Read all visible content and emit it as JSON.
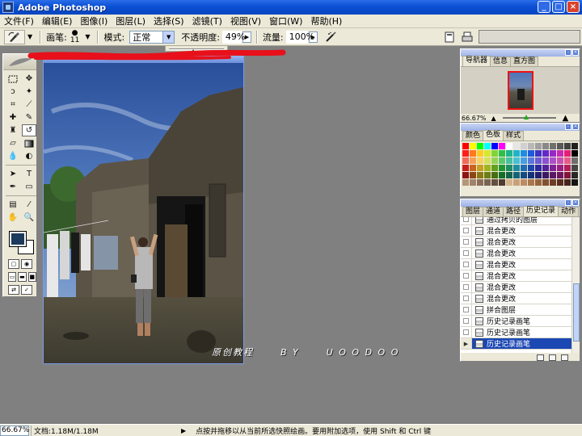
{
  "app": {
    "title": "Adobe Photoshop"
  },
  "window_buttons": {
    "minimize": "_",
    "maximize": "□",
    "close": "×"
  },
  "menu": [
    {
      "label": "文件(F)"
    },
    {
      "label": "编辑(E)"
    },
    {
      "label": "图像(I)"
    },
    {
      "label": "图层(L)"
    },
    {
      "label": "选择(S)"
    },
    {
      "label": "滤镜(T)"
    },
    {
      "label": "视图(V)"
    },
    {
      "label": "窗口(W)"
    },
    {
      "label": "帮助(H)"
    }
  ],
  "options": {
    "brush_label": "画笔:",
    "brush_size": "11",
    "mode_label": "模式:",
    "mode_value": "正常",
    "opacity_label": "不透明度:",
    "opacity_value": "49%",
    "flow_label": "流量:",
    "flow_value": "100%"
  },
  "navigator": {
    "tabs": [
      {
        "label": "导航器"
      },
      {
        "label": "信息"
      },
      {
        "label": "直方图"
      }
    ],
    "zoom": "66.67%"
  },
  "color_panel": {
    "tabs": [
      {
        "label": "颜色"
      },
      {
        "label": "色板"
      },
      {
        "label": "样式"
      }
    ],
    "swatches": [
      "#ff0000",
      "#ffff00",
      "#00ff00",
      "#00ffff",
      "#0000ff",
      "#ff00ff",
      "#ffffff",
      "#e6e6e6",
      "#d0d0d0",
      "#b8b8b8",
      "#a0a0a0",
      "#888888",
      "#707070",
      "#585858",
      "#404040",
      "#202020",
      "#ff1e1e",
      "#ff7a1e",
      "#ffcc1e",
      "#d6e82a",
      "#7fd43a",
      "#2fbf4a",
      "#1eb48c",
      "#1eb4c8",
      "#1e8ce6",
      "#1e5adc",
      "#3c32c8",
      "#6428c8",
      "#9628c8",
      "#c828b4",
      "#e61e78",
      "#000000",
      "#f26a5a",
      "#f5a05a",
      "#f8d05e",
      "#d4e05a",
      "#96d25a",
      "#5ac86e",
      "#46c0a0",
      "#46c0d2",
      "#469ee6",
      "#5a78dc",
      "#6e5ad2",
      "#8c50d2",
      "#aa50c8",
      "#c850b4",
      "#e65a8c",
      "#6e6e6e",
      "#c81e1e",
      "#c8641e",
      "#c8a01e",
      "#a0b41e",
      "#64a01e",
      "#1e9632",
      "#1e8c64",
      "#1e8ca0",
      "#1e6eb4",
      "#1e46aa",
      "#2d28a0",
      "#50239b",
      "#7d2396",
      "#9b1e87",
      "#b41e5a",
      "#464646",
      "#8c1414",
      "#8c4614",
      "#8c7814",
      "#6e7d14",
      "#466e14",
      "#146e28",
      "#14644b",
      "#146478",
      "#144b82",
      "#143278",
      "#231e6e",
      "#3c1964",
      "#5a1964",
      "#6e1464",
      "#82143c",
      "#282828",
      "#b49678",
      "#a0826e",
      "#8c6e5a",
      "#786450",
      "#645040",
      "#503c30",
      "#d2b48c",
      "#c8a078",
      "#be8c64",
      "#aa7850",
      "#96643c",
      "#825032",
      "#6e3c28",
      "#5a2d1e",
      "#46231e",
      "#141414"
    ]
  },
  "history": {
    "tabs": [
      {
        "label": "图层"
      },
      {
        "label": "通道"
      },
      {
        "label": "路径"
      },
      {
        "label": "历史记录"
      },
      {
        "label": "动作"
      }
    ],
    "items": [
      {
        "label": "通过拷贝的图层"
      },
      {
        "label": "混合更改"
      },
      {
        "label": "混合更改"
      },
      {
        "label": "混合更改"
      },
      {
        "label": "混合更改"
      },
      {
        "label": "混合更改"
      },
      {
        "label": "混合更改"
      },
      {
        "label": "混合更改"
      },
      {
        "label": "拼合图层"
      },
      {
        "label": "历史记录画笔"
      },
      {
        "label": "历史记录画笔"
      },
      {
        "label": "历史记录画笔"
      }
    ]
  },
  "watermark": "原创教程      B Y      U O O D O O",
  "colors": {
    "foreground": "#1b3a5c",
    "background": "#ffffff",
    "accent": "#0b4fd4",
    "scribble": "#e8101a"
  },
  "status": {
    "zoom": "66.67%",
    "doc_info": "文档:1.18M/1.18M",
    "hint": "点按并拖移以从当前所选快照绘画。要用附加选项，使用 Shift 和 Ctrl 键"
  }
}
